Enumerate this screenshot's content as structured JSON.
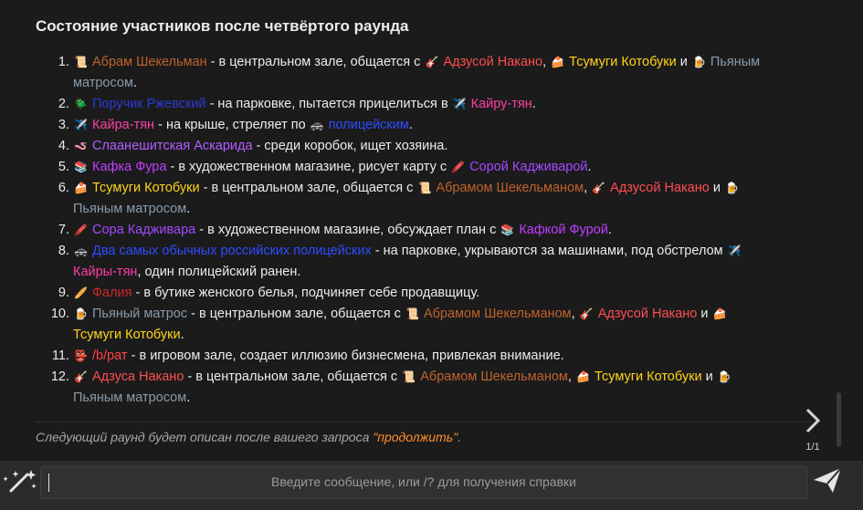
{
  "message": {
    "title": "Состояние участников после четвёртого раунда",
    "items": [
      {
        "num": "1.",
        "segments": [
          {
            "icon": "📜",
            "text": "Абрам Шекельман",
            "cls": "c-abram"
          },
          {
            "text": " - в центральном зале, общается с "
          },
          {
            "icon": "🎸",
            "text": "Адзусой Накано",
            "cls": "c-azusa"
          },
          {
            "text": ", "
          },
          {
            "icon": "🍰",
            "text": "Тсумуги Котобуки",
            "cls": "c-tsumugi"
          },
          {
            "text": " и "
          },
          {
            "icon": "🍺",
            "text": "Пьяным матросом",
            "cls": "c-drunk"
          },
          {
            "text": "."
          }
        ]
      },
      {
        "num": "2.",
        "segments": [
          {
            "icon": "🪲",
            "text": "Поручик Ржевский",
            "cls": "c-rzh"
          },
          {
            "text": " - на парковке, пытается прицелиться в "
          },
          {
            "icon": "✈️",
            "text": "Кайру-тян",
            "cls": "c-kairu"
          },
          {
            "text": "."
          }
        ]
      },
      {
        "num": "3.",
        "segments": [
          {
            "icon": "✈️",
            "text": "Кайра-тян",
            "cls": "c-kairu"
          },
          {
            "text": " - на крыше, стреляет по "
          },
          {
            "icon": "🚓",
            "text": "полицейским",
            "cls": "c-police"
          },
          {
            "text": "."
          }
        ]
      },
      {
        "num": "4.",
        "segments": [
          {
            "icon": "🪱",
            "text": "Слаанешитская Аскарида",
            "cls": "c-slaa"
          },
          {
            "text": " - среди коробок, ищет хозяина."
          }
        ]
      },
      {
        "num": "5.",
        "segments": [
          {
            "icon": "📚",
            "text": "Кафка Фура",
            "cls": "c-kafka"
          },
          {
            "text": " - в художественном магазине, рисует карту с "
          },
          {
            "icon": "🖍️",
            "text": "Сорой Кадживарой",
            "cls": "c-sora"
          },
          {
            "text": "."
          }
        ]
      },
      {
        "num": "6.",
        "segments": [
          {
            "icon": "🍰",
            "text": "Тсумуги Котобуки",
            "cls": "c-tsumugi"
          },
          {
            "text": " - в центральном зале, общается с "
          },
          {
            "icon": "📜",
            "text": "Абрамом Шекельманом",
            "cls": "c-abram"
          },
          {
            "text": ", "
          },
          {
            "icon": "🎸",
            "text": "Адзусой Накано",
            "cls": "c-azusa"
          },
          {
            "text": " и "
          },
          {
            "icon": "🍺",
            "text": "Пьяным матросом",
            "cls": "c-drunk"
          },
          {
            "text": "."
          }
        ]
      },
      {
        "num": "7.",
        "segments": [
          {
            "icon": "🖍️",
            "text": "Сора Кадживара",
            "cls": "c-sora"
          },
          {
            "text": " - в художественном магазине, обсуждает план с "
          },
          {
            "icon": "📚",
            "text": "Кафкой Фурой",
            "cls": "c-kafka"
          },
          {
            "text": "."
          }
        ]
      },
      {
        "num": "8.",
        "segments": [
          {
            "icon": "🚓",
            "text": "Два самых обычных российских полицейских",
            "cls": "c-police"
          },
          {
            "text": " - на парковке, укрываются за машинами, под обстрелом "
          },
          {
            "icon": "✈️",
            "text": "Кайры-тян",
            "cls": "c-kairu"
          },
          {
            "text": ", один полицейский ранен."
          }
        ]
      },
      {
        "num": "9.",
        "segments": [
          {
            "icon": "🥖",
            "text": "Фалия",
            "cls": "c-falia"
          },
          {
            "text": " - в бутике женского белья, подчиняет себе продавщицу."
          }
        ]
      },
      {
        "num": "10.",
        "segments": [
          {
            "icon": "🍺",
            "text": "Пьяный матрос",
            "cls": "c-drunk"
          },
          {
            "text": " - в центральном зале, общается с "
          },
          {
            "icon": "📜",
            "text": "Абрамом Шекельманом",
            "cls": "c-abram"
          },
          {
            "text": ", "
          },
          {
            "icon": "🎸",
            "text": "Адзусой Накано",
            "cls": "c-azusa"
          },
          {
            "text": " и "
          },
          {
            "icon": "🍰",
            "text": "Тсумуги Котобуки",
            "cls": "c-tsumugi"
          },
          {
            "text": "."
          }
        ]
      },
      {
        "num": "11.",
        "segments": [
          {
            "icon": "👺",
            "text": "/b/рат",
            "cls": "c-brat"
          },
          {
            "text": " - в игровом зале, создает иллюзию бизнесмена, привлекая внимание."
          }
        ]
      },
      {
        "num": "12.",
        "segments": [
          {
            "icon": "🎸",
            "text": "Адзуса Накано",
            "cls": "c-azusa"
          },
          {
            "text": " - в центральном зале, общается с "
          },
          {
            "icon": "📜",
            "text": "Абрамом Шекельманом",
            "cls": "c-abram"
          },
          {
            "text": ", "
          },
          {
            "icon": "🍰",
            "text": "Тсумуги Котобуки",
            "cls": "c-tsumugi"
          },
          {
            "text": " и "
          },
          {
            "icon": "🍺",
            "text": "Пьяным матросом",
            "cls": "c-drunk"
          },
          {
            "text": "."
          }
        ]
      }
    ],
    "footer": {
      "text_before": "Следующий раунд будет описан после вашего запроса ",
      "highlight": "\"продолжить\"",
      "text_after": "."
    }
  },
  "pager": {
    "count": "1/1",
    "next_icon": "chevron-right-icon"
  },
  "input": {
    "placeholder": "Введите сообщение, или /? для получения справки",
    "left_icon": "magic-wand-icon",
    "send_icon": "send-icon"
  }
}
